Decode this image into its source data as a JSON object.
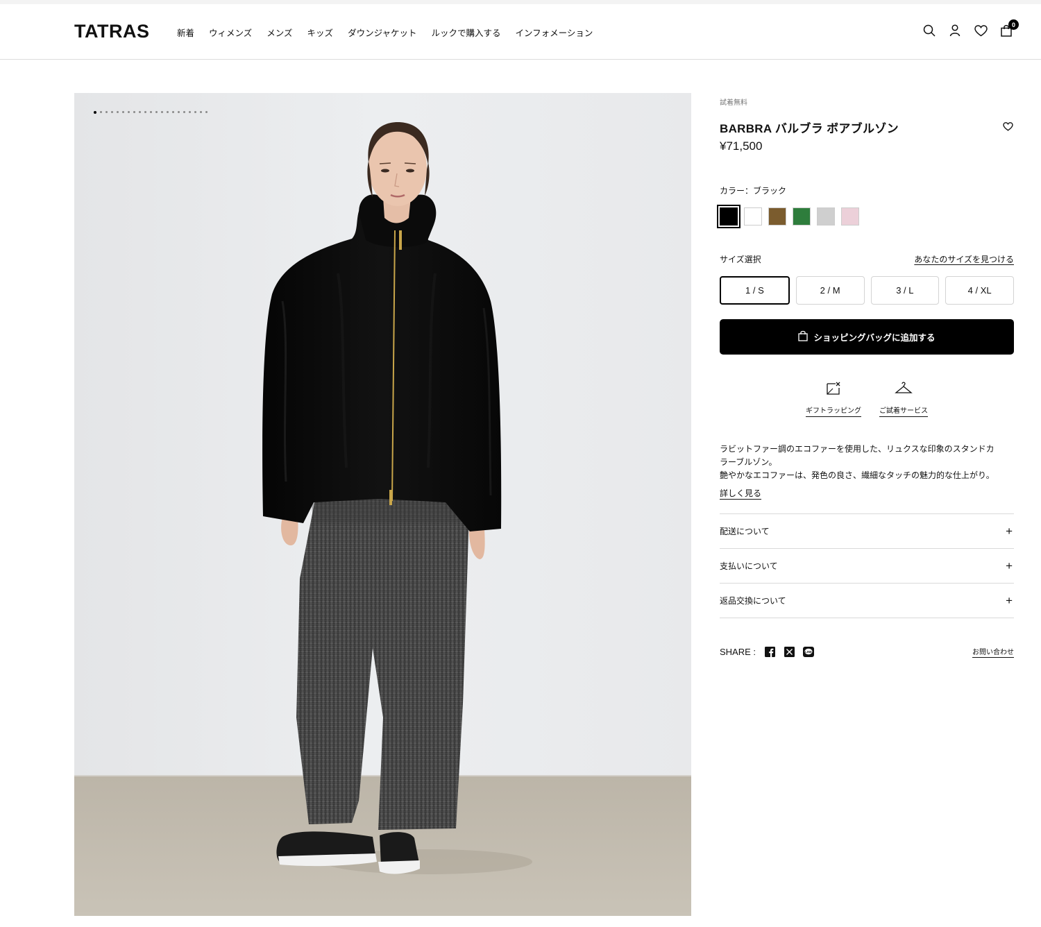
{
  "header": {
    "logo": "TATRAS",
    "nav": [
      "新着",
      "ウィメンズ",
      "メンズ",
      "キッズ",
      "ダウンジャケット",
      "ルックで購入する",
      "インフォメーション"
    ],
    "cart_count": "0",
    "icons": [
      "search-icon",
      "account-icon",
      "wishlist-icon",
      "cart-icon"
    ]
  },
  "gallery": {
    "image_count": 21,
    "active_index": 0
  },
  "product": {
    "tag": "試着無料",
    "title": "BARBRA バルブラ ボアブルゾン",
    "price": "¥71,500",
    "color_label": "カラー：ブラック",
    "colors": [
      {
        "name": "black",
        "hex": "#000000"
      },
      {
        "name": "white",
        "hex": "#ffffff"
      },
      {
        "name": "brown",
        "hex": "#7b5c2e"
      },
      {
        "name": "green",
        "hex": "#2e7d3c"
      },
      {
        "name": "grey",
        "hex": "#cfcfcf"
      },
      {
        "name": "pink",
        "hex": "#ecd0d9"
      }
    ],
    "selected_color": 0,
    "size_label": "サイズ選択",
    "size_finder": "あなたのサイズを見つける",
    "sizes": [
      "1 / S",
      "2 / M",
      "3 / L",
      "4 / XL"
    ],
    "selected_size": 0,
    "add_to_bag": "ショッピングバッグに追加する",
    "services": [
      "ギフトラッピング",
      "ご試着サービス"
    ],
    "description": [
      "ラビットファー調のエコファーを使用した、リュクスな印象のスタンドカ",
      "ラーブルゾン。",
      "艶やかなエコファーは、発色の良さ、繊細なタッチの魅力的な仕上がり。"
    ],
    "more": "詳しく見る",
    "accordion": [
      "配送について",
      "支払いについて",
      "返品交換について"
    ],
    "share_label": "SHARE :",
    "contact": "お問い合わせ"
  }
}
